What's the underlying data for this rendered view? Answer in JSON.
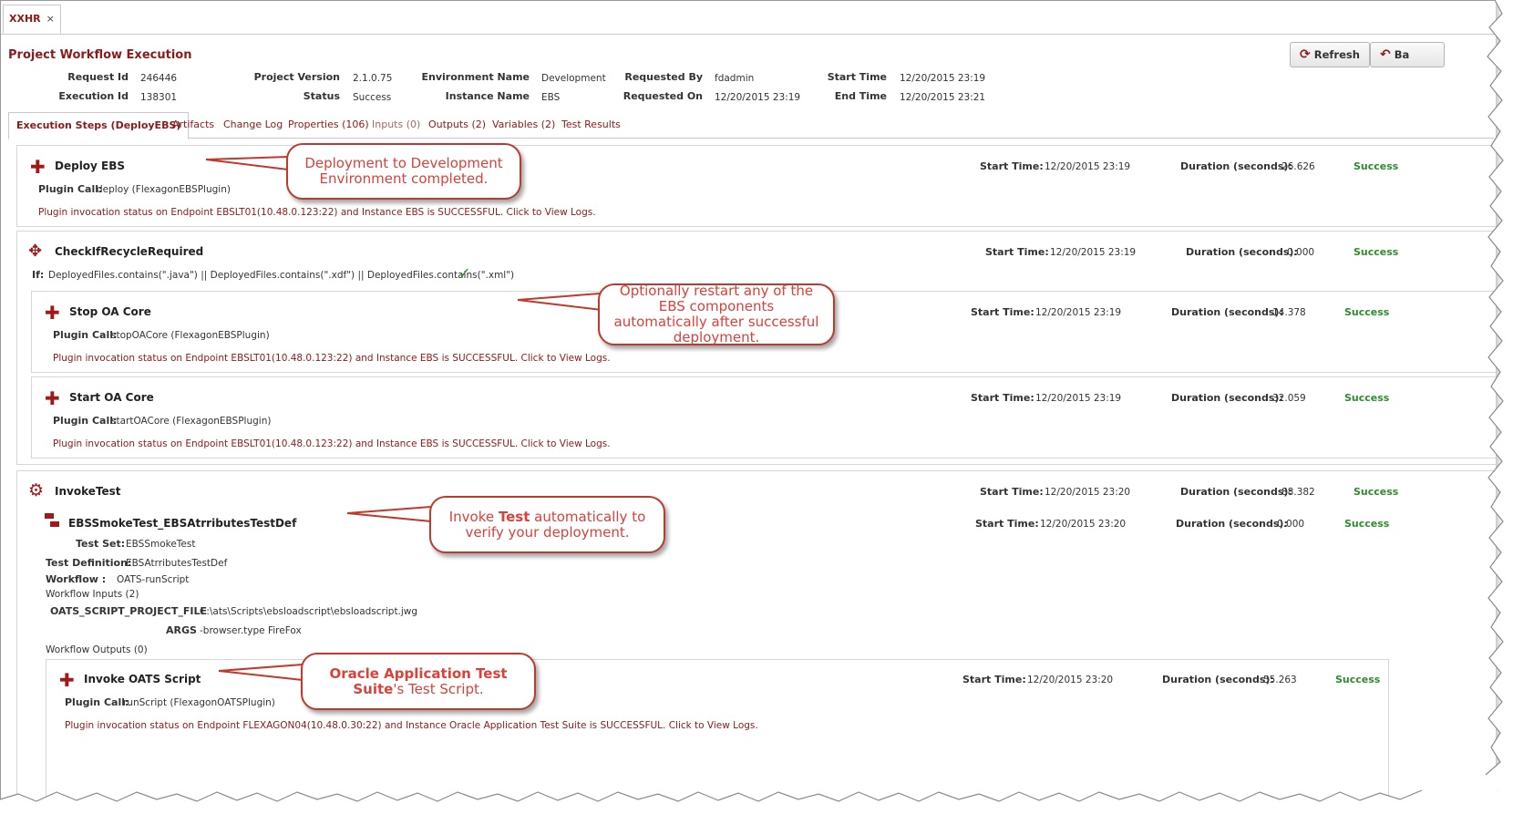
{
  "tab": {
    "label": "XXHR",
    "close": "×"
  },
  "page_title": "Project Workflow Execution",
  "buttons": {
    "refresh": "Refresh",
    "back": "Ba"
  },
  "header": {
    "request_id_label": "Request Id",
    "request_id": "246446",
    "execution_id_label": "Execution Id",
    "execution_id": "138301",
    "project_version_label": "Project Version",
    "project_version": "2.1.0.75",
    "status_label": "Status",
    "status": "Success",
    "env_label": "Environment Name",
    "env": "Development",
    "instance_label": "Instance Name",
    "instance": "EBS",
    "requested_by_label": "Requested By",
    "requested_by": "fdadmin",
    "requested_on_label": "Requested On",
    "requested_on": "12/20/2015 23:19",
    "start_label": "Start Time",
    "start": "12/20/2015 23:19",
    "end_label": "End Time",
    "end": "12/20/2015 23:21"
  },
  "subtabs": [
    "Execution Steps (DeployEBS)",
    "Artifacts",
    "Change Log",
    "Properties (106)",
    "Inputs (0)",
    "Outputs (2)",
    "Variables (2)",
    "Test Results"
  ],
  "labels": {
    "start_time": "Start Time:",
    "duration": "Duration (seconds):",
    "plugin_call": "Plugin Call:",
    "success": "Success",
    "if": "If:"
  },
  "steps": {
    "deploy": {
      "name": "Deploy EBS",
      "start": "12/20/2015 23:19",
      "duration": "26.626",
      "plugin": "deploy (FlexagonEBSPlugin)",
      "msg": "Plugin invocation status on Endpoint EBSLT01(10.48.0.123:22) and Instance EBS is SUCCESSFUL. Click to View Logs."
    },
    "check": {
      "name": "CheckIfRecycleRequired",
      "start": "12/20/2015 23:19",
      "duration": "0.000",
      "condition": "DeployedFiles.contains(\".java\") || DeployedFiles.contains(\".xdf\") || DeployedFiles.contains(\".xml\")"
    },
    "stop": {
      "name": "Stop OA Core",
      "start": "12/20/2015 23:19",
      "duration": "14.378",
      "plugin": "stopOACore (FlexagonEBSPlugin)",
      "msg": "Plugin invocation status on Endpoint EBSLT01(10.48.0.123:22) and Instance EBS is SUCCESSFUL. Click to View Logs."
    },
    "startoa": {
      "name": "Start OA Core",
      "start": "12/20/2015 23:19",
      "duration": "32.059",
      "plugin": "startOACore (FlexagonEBSPlugin)",
      "msg": "Plugin invocation status on Endpoint EBSLT01(10.48.0.123:22) and Instance EBS is SUCCESSFUL. Click to View Logs."
    },
    "invoke": {
      "name": "InvokeTest",
      "start": "12/20/2015 23:20",
      "duration": "88.382"
    },
    "smoke": {
      "name": "EBSSmokeTest_EBSAtrributesTestDef",
      "start": "12/20/2015 23:20",
      "duration": "0.000",
      "test_set_label": "Test Set:",
      "test_set": "EBSSmokeTest",
      "test_def_label": "Test Definition:",
      "test_def": "EBSAtrributesTestDef",
      "workflow_label": "Workflow :",
      "workflow": "OATS-runScript",
      "inputs_label": "Workflow Inputs (2)",
      "oats_file_label": "OATS_SCRIPT_PROJECT_FILE",
      "oats_file": "C:\\ats\\Scripts\\ebsloadscript\\ebsloadscript.jwg",
      "args_label": "ARGS",
      "args": "-browser.type FireFox",
      "outputs_label": "Workflow Outputs (0)"
    },
    "oats": {
      "name": "Invoke OATS Script",
      "start": "12/20/2015 23:20",
      "duration": "55.263",
      "plugin": "runScript (FlexagonOATSPlugin)",
      "msg": "Plugin invocation status on Endpoint FLEXAGON04(10.48.0.30:22) and Instance Oracle Application Test Suite is SUCCESSFUL. Click to View Logs."
    }
  },
  "callouts": {
    "c1": "Deployment to Development Environment completed.",
    "c2": "Optionally restart any of the EBS components automatically after successful deployment.",
    "c3_pre": "Invoke ",
    "c3_bold": "Test",
    "c3_post": " automatically to verify your deployment.",
    "c4_bold": "Oracle Application Test Suite",
    "c4_post": "'s Test Script."
  },
  "colors": {
    "brand": "#8b1a1a",
    "success": "#2e8b2e",
    "callout": "#d9413a"
  }
}
